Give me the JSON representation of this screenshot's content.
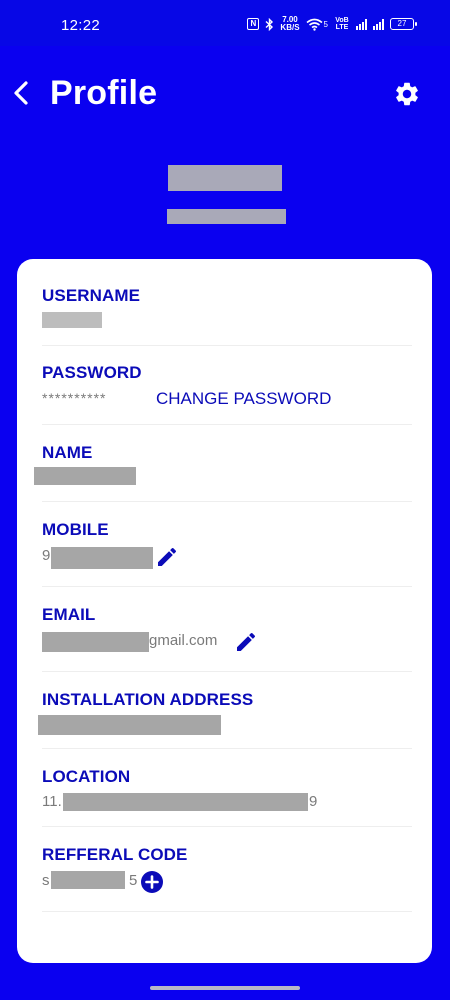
{
  "status_bar": {
    "time": "12:22",
    "nfc": "N",
    "network_speed_value": "7.00",
    "network_speed_unit": "KB/S",
    "wifi_label": "5",
    "volte_label": "VoB LTE",
    "battery_level": "27"
  },
  "header": {
    "title": "Profile",
    "back_icon": "chevron-left-icon",
    "settings_icon": "gear-icon"
  },
  "profile": {
    "fields": {
      "username": {
        "label": "USERNAME"
      },
      "password": {
        "label": "PASSWORD",
        "value": "**********",
        "action": "CHANGE PASSWORD"
      },
      "name": {
        "label": "NAME"
      },
      "mobile": {
        "label": "MOBILE",
        "value_prefix": "9"
      },
      "email": {
        "label": "EMAIL",
        "value_suffix": "gmail.com"
      },
      "installation_address": {
        "label": "INSTALLATION ADDRESS"
      },
      "location": {
        "label": "LOCATION",
        "value_prefix": "11.",
        "value_suffix": "9"
      },
      "referral_code": {
        "label": "REFFERAL CODE",
        "value_prefix": "s",
        "value_suffix": "5"
      }
    }
  },
  "colors": {
    "background": "#0a00f0",
    "card": "#ffffff",
    "label": "#0b0bb8",
    "value": "#7a7a7a",
    "redaction": "#a6a6a6"
  }
}
